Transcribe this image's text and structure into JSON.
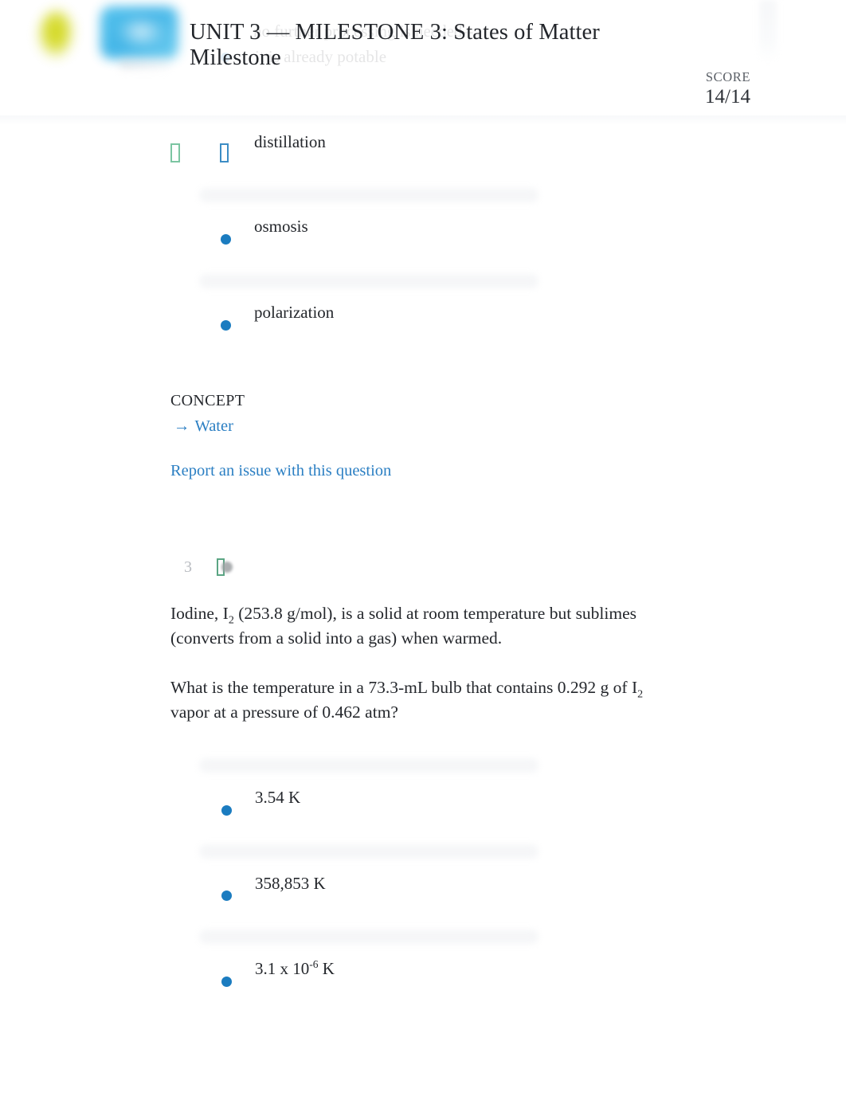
{
  "header": {
    "title": "UNIT 3 — MILESTONE 3: States of Matter Milestone",
    "score_label": "SCORE",
    "score_value": "14/14",
    "logo_leaf_icon": "leaf-logo-icon",
    "logo_brand_icon": "sophia-brand-logo-icon",
    "accent_color": "#2b7fc3",
    "bullet_color": "#1b7cc0",
    "correct_color": "#7cc5a2"
  },
  "previous_question_remnant": {
    "line_1": "no further processing is needed--",
    "line_2": "it is already potable"
  },
  "question_2": {
    "options": [
      {
        "label": "distillation",
        "state": "correct-and-selected",
        "correct_icon": "check-circle-icon",
        "selected_icon": "radio-selected-icon"
      },
      {
        "label": "osmosis",
        "state": "unselected",
        "bullet_icon": "radio-unselected-icon"
      },
      {
        "label": "polarization",
        "state": "unselected",
        "bullet_icon": "radio-unselected-icon"
      }
    ],
    "concept_label": "CONCEPT",
    "concept_arrow": "→",
    "concept_link": "Water",
    "report_link": "Report an issue with this question"
  },
  "question_3": {
    "number": "3",
    "flag_icon": "bookmark-flag-icon",
    "stem_paragraph_1_pre": "Iodine, I",
    "stem_paragraph_1_sub": "2",
    "stem_paragraph_1_post": " (253.8 g/mol), is a solid at room temperature but sublimes (converts from a solid into a gas) when warmed.",
    "stem_paragraph_2_pre": "What is the temperature in a 73.3-mL bulb that contains 0.292 g of I",
    "stem_paragraph_2_sub": "2",
    "stem_paragraph_2_post": " vapor at a pressure of 0.462 atm?",
    "options": [
      {
        "label": "3.54 K",
        "bullet_icon": "radio-unselected-icon"
      },
      {
        "label": "358,853 K",
        "bullet_icon": "radio-unselected-icon"
      },
      {
        "label": "3.1 x 10",
        "superscript": "-6",
        "suffix": " K",
        "bullet_icon": "radio-unselected-icon"
      }
    ]
  }
}
